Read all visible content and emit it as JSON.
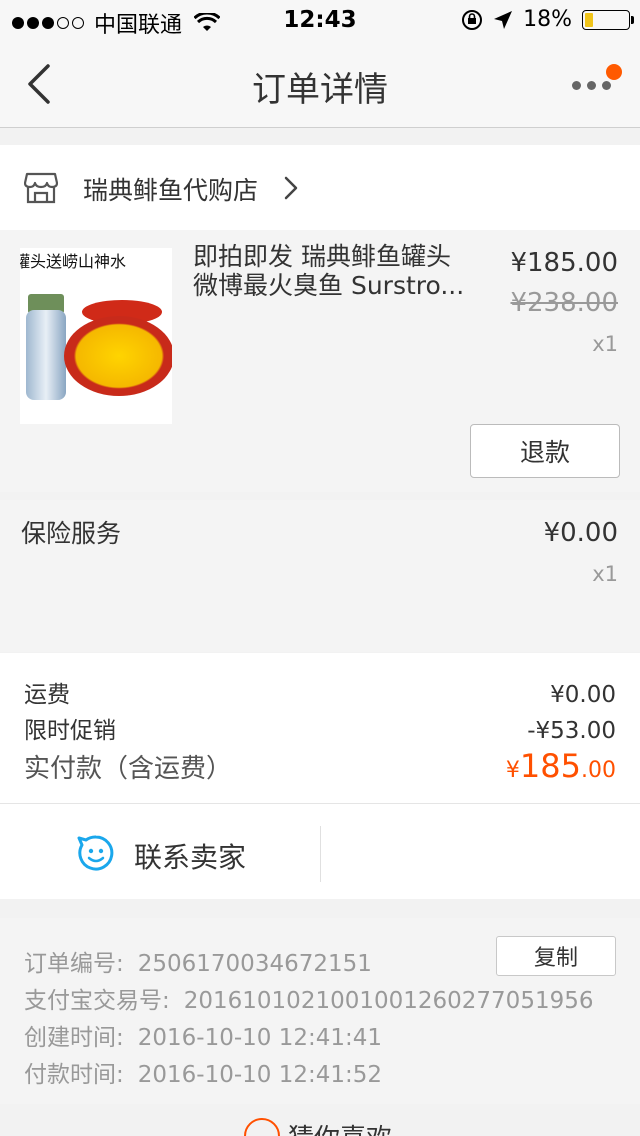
{
  "status_bar": {
    "carrier": "中国联通",
    "time": "12:43",
    "battery": "18%",
    "battery_level": 0.18
  },
  "nav": {
    "title": "订单详情"
  },
  "shop": {
    "name": "瑞典鲱鱼代购店"
  },
  "product": {
    "image_banner": "罐头送崂山神水",
    "title_line1": "即拍即发 瑞典鲱鱼罐头",
    "title_line2": "微博最火臭鱼 Surstro...",
    "price": "¥185.00",
    "original_price": "¥238.00",
    "quantity": "x1",
    "refund_label": "退款"
  },
  "insurance": {
    "label": "保险服务",
    "price": "¥0.00",
    "quantity": "x1"
  },
  "costs": {
    "shipping_label": "运费",
    "shipping_value": "¥0.00",
    "promo_label": "限时促销",
    "promo_value": "-¥53.00",
    "total_label": "实付款（含运费）",
    "total_currency": "¥",
    "total_integer": "185",
    "total_decimal": ".00"
  },
  "contact": {
    "label": "联系卖家"
  },
  "order_info": {
    "order_no_label": "订单编号:",
    "order_no": "2506170034672151",
    "copy_label": "复制",
    "alipay_label": "支付宝交易号:",
    "alipay_no": "2016101021001001260277051956",
    "created_label": "创建时间:",
    "created_time": "2016-10-10 12:41:41",
    "paid_label": "付款时间:",
    "paid_time": "2016-10-10 12:41:52"
  },
  "guess": {
    "label": "猜你喜欢"
  },
  "colors": {
    "accent": "#ff5000",
    "notification": "#ff5a00",
    "battery": "#f0c419",
    "contact_icon": "#1aa7ec"
  }
}
